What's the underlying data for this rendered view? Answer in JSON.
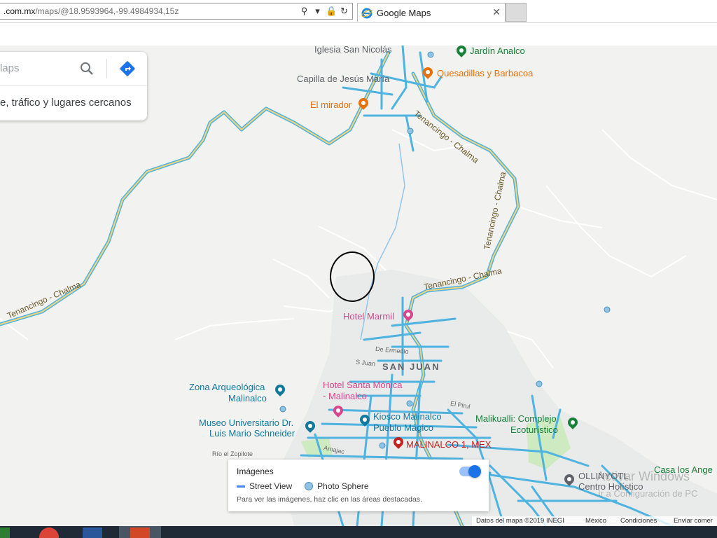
{
  "browser": {
    "address_domain": ".com.mx",
    "address_path": "/maps/@18.9593964,-99.4984934,15z",
    "tab_title": "Google Maps",
    "icons": [
      "search-icon",
      "dropdown-icon",
      "lock-icon",
      "refresh-icon",
      "close-icon"
    ]
  },
  "search": {
    "placeholder_partial": "laps",
    "subtitle": "e, tráfico y lugares cercanos"
  },
  "map": {
    "places": {
      "iglesia": "Iglesia San Nicolás",
      "jardin": "Jardín Analco",
      "quesadillas": "Quesadillas y Barbacoa",
      "capilla": "Capilla de Jesús María",
      "mirador": "El mirador",
      "hotel_marmil": "Hotel Marmil",
      "san_juan": "SAN JUAN",
      "zona1": "Zona Arqueológica",
      "zona2": "Malinalco",
      "hotel_sm1": "Hotel Santa Mónica",
      "hotel_sm2": "- Malinalco",
      "museo1": "Museo Universitario Dr.",
      "museo2": "Luis Mario Schneider",
      "kiosco1": "Kiosco Malinalco",
      "kiosco2": "Pueblo Mágico",
      "malinalco1": "MALINALCO 1, MEX",
      "malikualli1": "Malikualli: Complejo",
      "malikualli2": "Ecoturístico",
      "ollin1": "OLLINYOTL",
      "ollin2": "Centro Holístico",
      "casa": "Casa los Ange"
    },
    "roads": {
      "tc_top": "Tenancingo - Chalma",
      "tc_mid": "Tenancingo - Chalma",
      "tc_left": "Tenancingo - Chalma",
      "tc_lower": "Tenancingo - Chalma",
      "de_ermedio": "De Ermedio",
      "s_juan": "S Juan",
      "el_pirul": "El Pirul",
      "rio_zopilote": "Río el Zopilote",
      "amajac": "Amajac"
    }
  },
  "street_view_panel": {
    "title": "Imágenes",
    "street_view": "Street View",
    "photo_sphere": "Photo Sphere",
    "hint": "Para ver las imágenes, haz clic en las áreas destacadas.",
    "toggle_on": true
  },
  "footer": {
    "data": "Datos del mapa ©2019 INEGI",
    "country": "México",
    "terms": "Condiciones",
    "feedback": "Enviar comer"
  },
  "watermark": {
    "line1": "Activar Windows",
    "line2": "Ir a Configuración de PC"
  },
  "colors": {
    "street_view": "#4fb3e0",
    "highway": "#f4d47a",
    "water": "#8fc6ef",
    "map_bg": "#f2f2f0"
  }
}
